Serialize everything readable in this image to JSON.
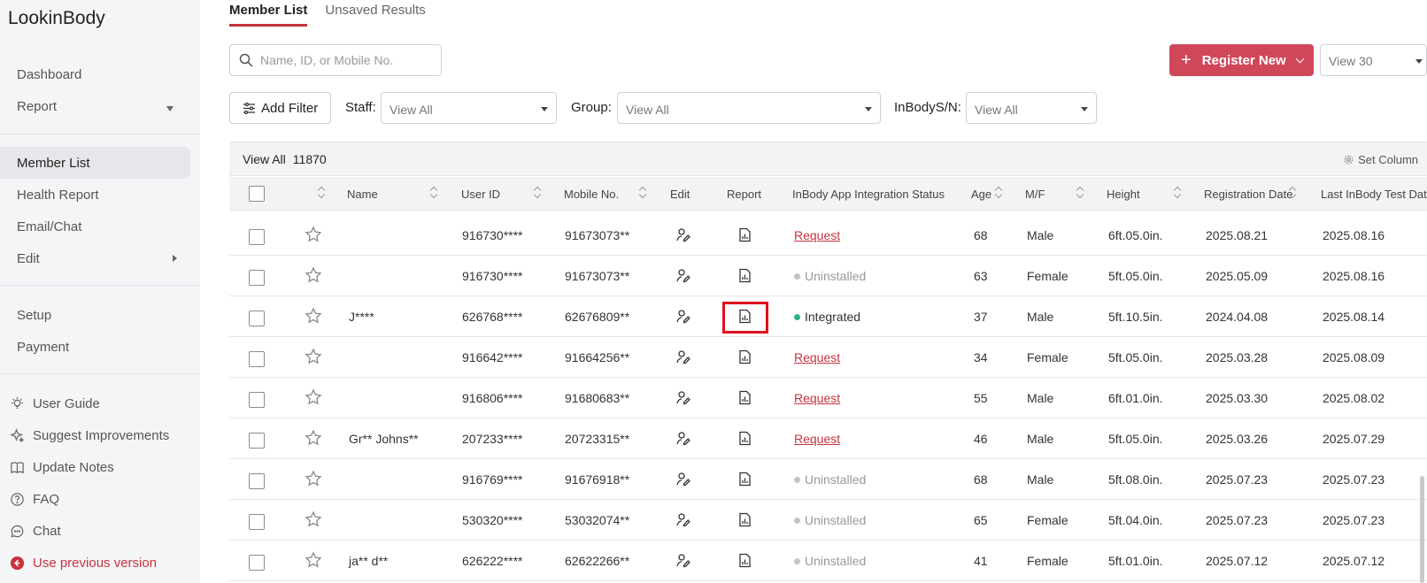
{
  "app": {
    "logo": "LookinBody"
  },
  "sidebar": {
    "dashboard": "Dashboard",
    "report": "Report",
    "member_list": "Member List",
    "health_report": "Health Report",
    "email_chat": "Email/Chat",
    "edit": "Edit",
    "setup": "Setup",
    "payment": "Payment",
    "user_guide": "User Guide",
    "suggest": "Suggest Improvements",
    "update_notes": "Update Notes",
    "faq": "FAQ",
    "chat": "Chat",
    "previous": "Use previous version"
  },
  "tabs": {
    "member_list": "Member List",
    "unsaved": "Unsaved Results"
  },
  "search": {
    "placeholder": "Name, ID, or Mobile No."
  },
  "toolbar": {
    "register": "Register New",
    "view_count": "View 30",
    "add_filter": "Add Filter",
    "staff_label": "Staff:",
    "staff_value": "View All",
    "group_label": "Group:",
    "group_value": "View All",
    "sn_label": "InBodyS/N:",
    "sn_value": "View All"
  },
  "table": {
    "view_all": "View All",
    "total": "11870",
    "set_column": "Set Column",
    "headers": {
      "name": "Name",
      "user_id": "User ID",
      "mobile": "Mobile No.",
      "edit": "Edit",
      "report": "Report",
      "integration": "InBody App Integration Status",
      "age": "Age",
      "gender": "M/F",
      "height": "Height",
      "registration": "Registration Date",
      "last_test": "Last InBody Test Date"
    },
    "rows": [
      {
        "name": "",
        "user_id": "916730****",
        "mobile": "91673073**",
        "status": "Request",
        "status_type": "request",
        "age": "68",
        "gender": "Male",
        "height": "6ft.05.0in.",
        "registration": "2025.08.21",
        "last_test": "2025.08.16"
      },
      {
        "name": "",
        "user_id": "916730****",
        "mobile": "91673073**",
        "status": "Uninstalled",
        "status_type": "uninstalled",
        "age": "63",
        "gender": "Female",
        "height": "5ft.05.0in.",
        "registration": "2025.05.09",
        "last_test": "2025.08.16"
      },
      {
        "name": "J****",
        "user_id": "626768****",
        "mobile": "62676809**",
        "status": "Integrated",
        "status_type": "integrated",
        "age": "37",
        "gender": "Male",
        "height": "5ft.10.5in.",
        "registration": "2024.04.08",
        "last_test": "2025.08.14"
      },
      {
        "name": "",
        "user_id": "916642****",
        "mobile": "91664256**",
        "status": "Request",
        "status_type": "request",
        "age": "34",
        "gender": "Female",
        "height": "5ft.05.0in.",
        "registration": "2025.03.28",
        "last_test": "2025.08.09"
      },
      {
        "name": "",
        "user_id": "916806****",
        "mobile": "91680683**",
        "status": "Request",
        "status_type": "request",
        "age": "55",
        "gender": "Male",
        "height": "6ft.01.0in.",
        "registration": "2025.03.30",
        "last_test": "2025.08.02"
      },
      {
        "name": "Gr** Johns**",
        "user_id": "207233****",
        "mobile": "20723315**",
        "status": "Request",
        "status_type": "request",
        "age": "46",
        "gender": "Male",
        "height": "5ft.05.0in.",
        "registration": "2025.03.26",
        "last_test": "2025.07.29"
      },
      {
        "name": "",
        "user_id": "916769****",
        "mobile": "91676918**",
        "status": "Uninstalled",
        "status_type": "uninstalled",
        "age": "68",
        "gender": "Male",
        "height": "5ft.08.0in.",
        "registration": "2025.07.23",
        "last_test": "2025.07.23"
      },
      {
        "name": "",
        "user_id": "530320****",
        "mobile": "53032074**",
        "status": "Uninstalled",
        "status_type": "uninstalled",
        "age": "65",
        "gender": "Female",
        "height": "5ft.04.0in.",
        "registration": "2025.07.23",
        "last_test": "2025.07.23"
      },
      {
        "name": "ja** d**",
        "user_id": "626222****",
        "mobile": "62622266**",
        "status": "Uninstalled",
        "status_type": "uninstalled",
        "age": "41",
        "gender": "Female",
        "height": "5ft.01.0in.",
        "registration": "2025.07.12",
        "last_test": "2025.07.12"
      }
    ]
  },
  "colors": {
    "accent": "#c8323f",
    "button": "#d0475a",
    "integrated": "#2fb384",
    "highlight": "#e0101c"
  },
  "icons": [
    "search-icon",
    "filter-icon",
    "gear-icon",
    "star-icon",
    "edit-person-icon",
    "report-document-icon",
    "lightbulb-icon",
    "sparkle-icon",
    "book-icon",
    "question-icon",
    "chat-icon",
    "back-arrow-icon"
  ]
}
